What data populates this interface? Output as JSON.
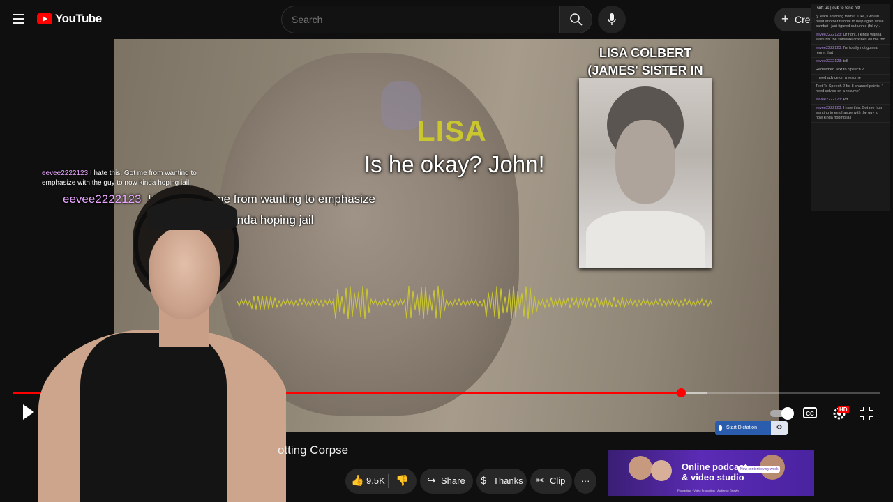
{
  "header": {
    "logo_text": "YouTube",
    "search_placeholder": "Search",
    "create_label": "Create"
  },
  "stream_chat": {
    "header": "Gift us | sub to tone hit!",
    "messages": [
      {
        "user": "",
        "text": "ty learn anything from it. Like, I would need another tutorial to help again while bambai i just figured out unnie (ful ry)."
      },
      {
        "user": "eevee2222123:",
        "text": "Ur right, I kinda wanna wait until the software crashes on me tho"
      },
      {
        "user": "eevee2222123:",
        "text": "I'm totally not gonna regret that"
      },
      {
        "user": "eevee2222123:",
        "text": "tell"
      },
      {
        "user": "",
        "text": "Redeemed Text to Speech 2"
      },
      {
        "user": "",
        "text": "I need advice on a resume"
      },
      {
        "user": "",
        "text": "Text To Speech 2 for 8 channel points! 'I need advice on a resume'"
      },
      {
        "user": "eevee2222123:",
        "text": "Pff"
      },
      {
        "user": "eevee2222123:",
        "text": "I hate this. Got me from wanting to emphasize with the guy to now kinda hoping jail"
      }
    ]
  },
  "video": {
    "speaker_label": "LISA",
    "subtitle": "Is he okay? John!",
    "photo_caption_line1": "LISA COLBERT",
    "photo_caption_line2": "(JAMES' SISTER IN LAW)"
  },
  "overlay_chat": {
    "user": "eevee2222123",
    "small_text": "I hate this. Got me from wanting to emphasize with the guy to now kinda hoping jail",
    "big_text_line1": "I hate th       me from wanting to emphasize",
    "big_text_line2": "wit                   w kinda hoping jail"
  },
  "player": {
    "progress_played_fraction": 0.77,
    "progress_loaded_fraction": 0.8,
    "hd_badge": "HD",
    "cc_label": "CC",
    "dictation_label": "Start Dictation"
  },
  "below_video": {
    "title_fragment": "otting Corpse",
    "like_count": "9.5K",
    "share_label": "Share",
    "thanks_label": "Thanks",
    "clip_label": "Clip",
    "more_label": "···"
  },
  "ad": {
    "headline_line1": "Online podcast",
    "headline_line2": "& video studio",
    "badge": "New content every week",
    "strip": "Podcasting · Video Production · Audience Growth"
  },
  "colors": {
    "progress_red": "#ff0000",
    "lisa_yellow": "#c9c630",
    "chat_name_pink": "#e8a7ff",
    "ad_purple": "#5b2bb5"
  }
}
